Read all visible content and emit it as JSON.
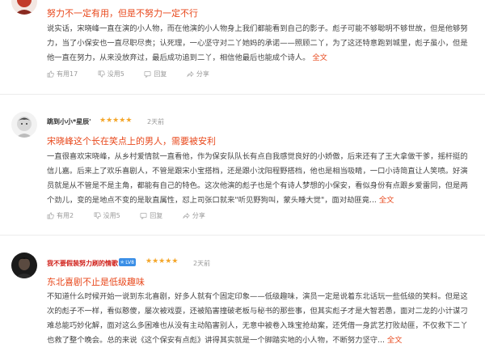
{
  "reviews": [
    {
      "username": "",
      "time": "",
      "title": "努力不一定有用，但是不努力一定不行",
      "lines": [
        "说实话，宋晓峰一直在演的小人物，而在他演的小人物身上我们都能看到自己的影子。彪子可能不够聪明不够世故，但是他够努",
        "力，当了小保安也一直尽职尽责；认死理，一心坚守对二丫她妈的承诺——照顾二丫，为了这还特意跑到城里，彪子虽小，但是",
        "他一直在努力，从来没放弃过，最后成功追到二丫，相信他最后也能成个诗人。"
      ],
      "full_text": "全文",
      "useful": "有用17",
      "useless": "没用5",
      "reply": "回复",
      "share": "分享"
    },
    {
      "username": "跳到小小*星辰'",
      "time": "2天前",
      "title": "宋晓峰这个长在笑点上的男人，需要被安利",
      "lines": [
        "一直很喜欢宋晓峰，从乡村爱情就一直看他，作为保安队队长有点自我感觉良好的小娇傲，后来还有了王大拿做干爹，摇杆挺的",
        "信儿嘉。后来上了欢乐喜剧人，不管是跟宋小宝搭档，还是跟小沈阳程野搭档，他也是相当吸睛，一口小诗简直让人笑喷。好演",
        "员就是从不管是不是主角，都能有自己的特色。这次他演的彪子也是个有诗人梦想的小保安，看似身份有点跟乡爱雷同，但是两",
        "个劲儿，变的是地点不变的是耿直属性，怼上司张口就来\"听见野狗叫，蒙头睡大觉\"，面对劫匪竟..."
      ],
      "full_text": "全文",
      "useful": "有用2",
      "useless": "没用5",
      "reply": "回复",
      "share": "分享"
    },
    {
      "username": "我不要假装努力刷的情歌",
      "badge": "LV8",
      "time": "2天前",
      "title": "东北喜剧不止是低级趣味",
      "lines": [
        "不知道什么时候开始一说到东北喜剧，好多人就有个固定印象——低级趣味，演员一定是说着东北话玩一些低级的笑料。但是这",
        "次的彪子不一样，看似憨傻，屡次被戏耍，还被陷害撞破老板与秘书的那些事，但其实彪子才是大智若愚，面对二龙的小计谋刁",
        "难总能巧妙化解，面对这么多困难也从没有主动陷害别人，无意中被卷入珠宝抢劫案，还凭借一身武艺打败劫匪，不仅救下二丫",
        "也救了整个晚会。总的来说《这个保安有点彪》讲得其实就是一个脚踏实地的小人物，不断努力坚守..."
      ],
      "full_text": "全文"
    }
  ],
  "colors": {
    "accent": "#e8481c",
    "star": "#f4a62a",
    "username_red": "#d0211b",
    "badge": "#3a8ee6"
  }
}
